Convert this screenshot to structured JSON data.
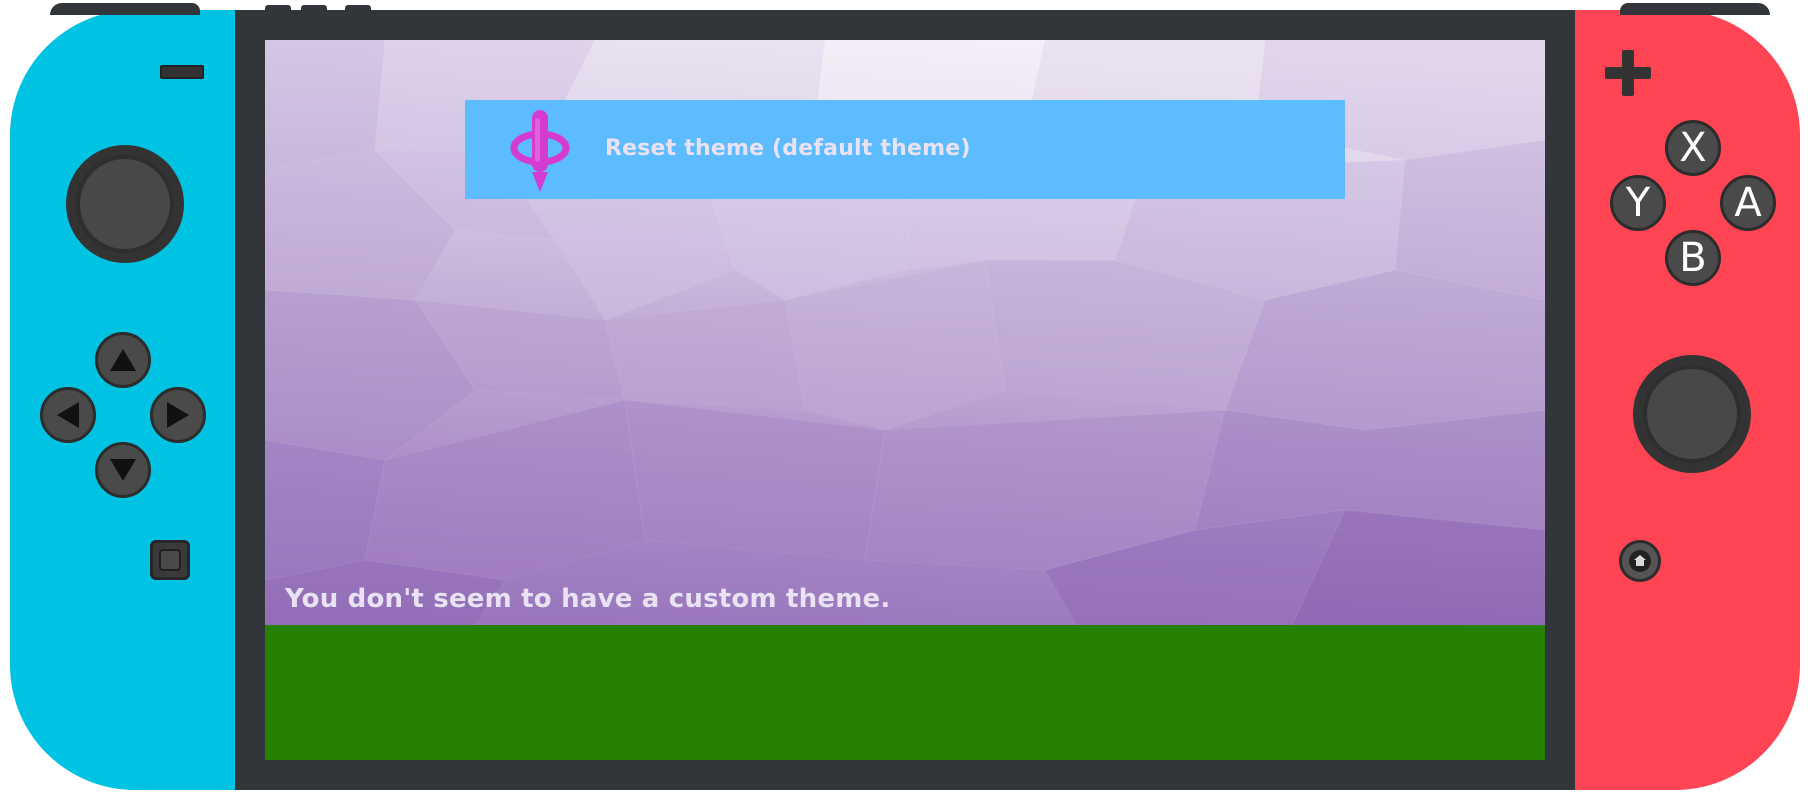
{
  "colors": {
    "left_joycon": "#00C3E3",
    "right_joycon": "#FF4554",
    "body": "#32363A",
    "accent": "#5DBCFF",
    "screen_bottom": "#268000",
    "text_light": "#E8E2F2",
    "icon_pink": "#D43BD0"
  },
  "left_controller": {
    "minus_icon": "minus-icon",
    "dpad": [
      "up-arrow-icon",
      "left-arrow-icon",
      "right-arrow-icon",
      "down-arrow-icon"
    ],
    "capture_icon": "capture-icon"
  },
  "right_controller": {
    "plus_icon": "plus-icon",
    "buttons": {
      "x": "X",
      "y": "Y",
      "a": "A",
      "b": "B"
    },
    "home_icon": "home-icon"
  },
  "screen": {
    "menu_item": {
      "icon": "rocket-icon",
      "label": "Reset theme (default theme)"
    },
    "message": "You don't seem to have a custom theme."
  }
}
